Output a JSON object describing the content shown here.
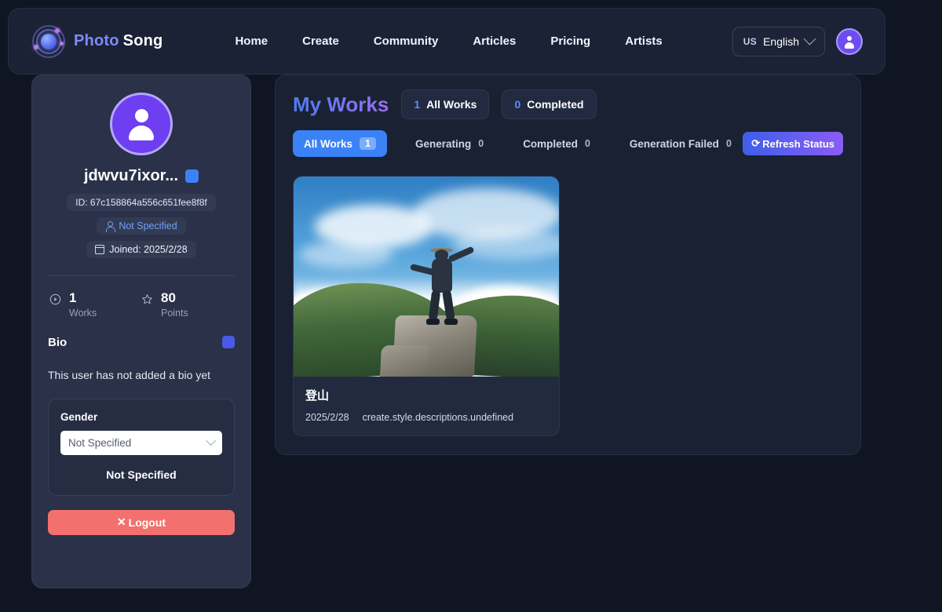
{
  "header": {
    "brand": {
      "photo": "Photo",
      "song": "Song",
      "logo_icon": "orbit-logo-icon"
    },
    "nav": [
      {
        "label": "Home"
      },
      {
        "label": "Create"
      },
      {
        "label": "Community"
      },
      {
        "label": "Articles"
      },
      {
        "label": "Pricing"
      },
      {
        "label": "Artists"
      }
    ],
    "language": {
      "code": "US",
      "label": "English",
      "chevron_icon": "chevron-down-icon"
    },
    "avatar_icon": "user-avatar-icon"
  },
  "sidebar": {
    "avatar_icon": "user-avatar-icon",
    "username": "jdwvu7ixor...",
    "edit_name_icon": "edit-icon",
    "id": "ID: 67c158864a556c651fee8f8f",
    "gender_chip": {
      "icon": "person-icon",
      "label": "Not Specified"
    },
    "joined_chip": {
      "icon": "calendar-icon",
      "label": "Joined: 2025/2/28"
    },
    "stats": [
      {
        "icon": "play-circle-icon",
        "value": "1",
        "label": "Works"
      },
      {
        "icon": "star-icon",
        "value": "80",
        "label": "Points"
      }
    ],
    "bio": {
      "title": "Bio",
      "edit_icon": "edit-icon",
      "text": "This user has not added a bio yet"
    },
    "gender_card": {
      "label": "Gender",
      "select_value": "Not Specified",
      "select_chevron_icon": "chevron-down-icon",
      "current_value": "Not Specified"
    },
    "logout": {
      "icon": "close-icon",
      "label": "Logout"
    }
  },
  "main": {
    "title": "My Works",
    "stat_pills": [
      {
        "count": "1",
        "label": "All Works"
      },
      {
        "count": "0",
        "label": "Completed"
      }
    ],
    "filters": [
      {
        "label": "All Works",
        "count": "1",
        "active": true
      },
      {
        "label": "Generating",
        "count": "0",
        "active": false
      },
      {
        "label": "Completed",
        "count": "0",
        "active": false
      },
      {
        "label": "Generation Failed",
        "count": "0",
        "active": false
      }
    ],
    "refresh": {
      "icon": "refresh-icon",
      "label": "Refresh Status"
    },
    "work_card": {
      "image_alt": "mountain-summit-photo",
      "title": "登山",
      "date": "2025/2/28",
      "description": "create.style.descriptions.undefined"
    }
  },
  "colors": {
    "page_bg": "#101524",
    "panel_bg": "#1a2133",
    "sidebar_bg": "#2a3148",
    "accent_blue": "#3b82f6",
    "accent_purple": "#8b5cf6",
    "danger_red": "#f2716f"
  }
}
